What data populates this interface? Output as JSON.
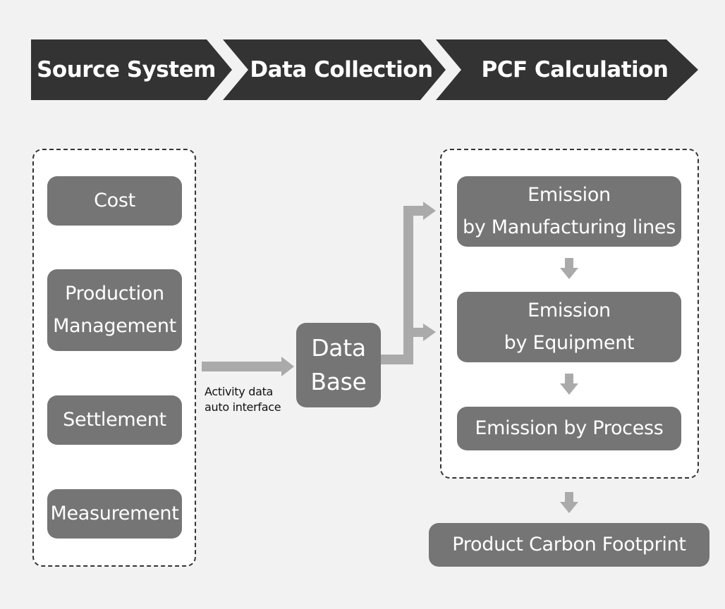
{
  "colors": {
    "background": "#f2f2f2",
    "header_fill": "#333333",
    "node_fill": "#757575",
    "arrow_fill": "#aaaaaa",
    "group_fill": "#ffffff",
    "group_border": "#333333"
  },
  "header": {
    "stages": [
      {
        "label": "Source System"
      },
      {
        "label": "Data Collection"
      },
      {
        "label": "PCF Calculation"
      }
    ]
  },
  "source_systems": {
    "items": [
      {
        "lines": [
          "Cost"
        ]
      },
      {
        "lines": [
          "Production",
          "Management"
        ]
      },
      {
        "lines": [
          "Settlement"
        ]
      },
      {
        "lines": [
          "Measurement"
        ]
      }
    ]
  },
  "connector": {
    "caption_lines": [
      "Activity data",
      "auto interface"
    ]
  },
  "database": {
    "lines": [
      "Data",
      "Base"
    ]
  },
  "pcf_calculation": {
    "steps": [
      {
        "lines": [
          "Emission",
          "by Manufacturing lines"
        ]
      },
      {
        "lines": [
          "Emission",
          "by Equipment"
        ]
      },
      {
        "lines": [
          "Emission by Process"
        ]
      }
    ]
  },
  "result": {
    "label": "Product Carbon Footprint"
  }
}
